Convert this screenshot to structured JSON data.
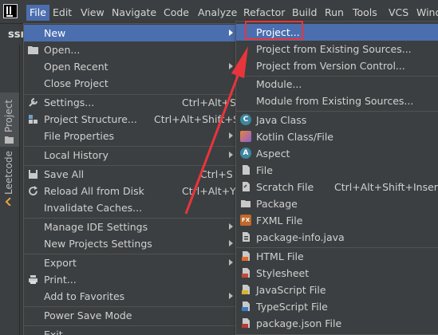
{
  "menubar": {
    "items": [
      "File",
      "Edit",
      "View",
      "Navigate",
      "Code",
      "Analyze",
      "Refactor",
      "Build",
      "Run",
      "Tools",
      "VCS",
      "Wind"
    ]
  },
  "editor": {
    "tab_fragment": "ssr"
  },
  "sidebar": {
    "tabs": [
      "Project",
      "Leetcode"
    ]
  },
  "file_menu": {
    "items": [
      {
        "label": "New",
        "shortcut": "",
        "submenu": true,
        "highlighted": true
      },
      {
        "label": "Open...",
        "shortcut": "",
        "icon": "folder-icon"
      },
      {
        "label": "Open Recent",
        "shortcut": "",
        "submenu": true
      },
      {
        "label": "Close Project",
        "shortcut": ""
      },
      {
        "label": "Settings...",
        "shortcut": "Ctrl+Alt+S",
        "icon": "wrench-icon"
      },
      {
        "label": "Project Structure...",
        "shortcut": "Ctrl+Alt+Shift+S",
        "icon": "structure-icon"
      },
      {
        "label": "File Properties",
        "shortcut": "",
        "submenu": true
      },
      {
        "label": "Local History",
        "shortcut": "",
        "submenu": true
      },
      {
        "label": "Save All",
        "shortcut": "Ctrl+S",
        "icon": "save-icon"
      },
      {
        "label": "Reload All from Disk",
        "shortcut": "Ctrl+Alt+Y",
        "icon": "reload-icon"
      },
      {
        "label": "Invalidate Caches...",
        "shortcut": ""
      },
      {
        "label": "Manage IDE Settings",
        "shortcut": "",
        "submenu": true
      },
      {
        "label": "New Projects Settings",
        "shortcut": "",
        "submenu": true
      },
      {
        "label": "Export",
        "shortcut": "",
        "submenu": true
      },
      {
        "label": "Print...",
        "shortcut": "",
        "icon": "print-icon"
      },
      {
        "label": "Add to Favorites",
        "shortcut": "",
        "submenu": true
      },
      {
        "label": "Power Save Mode",
        "shortcut": ""
      },
      {
        "label": "Exit",
        "shortcut": ""
      }
    ]
  },
  "new_submenu": {
    "items": [
      {
        "label": "Project...",
        "shortcut": "",
        "highlighted": true
      },
      {
        "label": "Project from Existing Sources...",
        "shortcut": ""
      },
      {
        "label": "Project from Version Control...",
        "shortcut": ""
      },
      {
        "label": "Module...",
        "shortcut": ""
      },
      {
        "label": "Module from Existing Sources...",
        "shortcut": ""
      },
      {
        "label": "Java Class",
        "shortcut": "",
        "icon": "java-class-icon"
      },
      {
        "label": "Kotlin Class/File",
        "shortcut": "",
        "icon": "kotlin-icon"
      },
      {
        "label": "Aspect",
        "shortcut": "",
        "icon": "aspect-icon"
      },
      {
        "label": "File",
        "shortcut": "",
        "icon": "file-icon"
      },
      {
        "label": "Scratch File",
        "shortcut": "Ctrl+Alt+Shift+Insert",
        "icon": "scratch-file-icon"
      },
      {
        "label": "Package",
        "shortcut": "",
        "icon": "package-icon"
      },
      {
        "label": "FXML File",
        "shortcut": "",
        "icon": "fxml-icon"
      },
      {
        "label": "package-info.java",
        "shortcut": "",
        "icon": "package-info-icon"
      },
      {
        "label": "HTML File",
        "shortcut": "",
        "icon": "html-icon"
      },
      {
        "label": "Stylesheet",
        "shortcut": "",
        "icon": "css-icon"
      },
      {
        "label": "JavaScript File",
        "shortcut": "",
        "icon": "js-icon"
      },
      {
        "label": "TypeScript File",
        "shortcut": "",
        "icon": "ts-icon"
      },
      {
        "label": "package.json File",
        "shortcut": "",
        "icon": "npm-icon"
      }
    ]
  },
  "colors": {
    "highlight": "#4b6eaf",
    "annotation": "#e8353b",
    "background": "#3c3f41"
  }
}
